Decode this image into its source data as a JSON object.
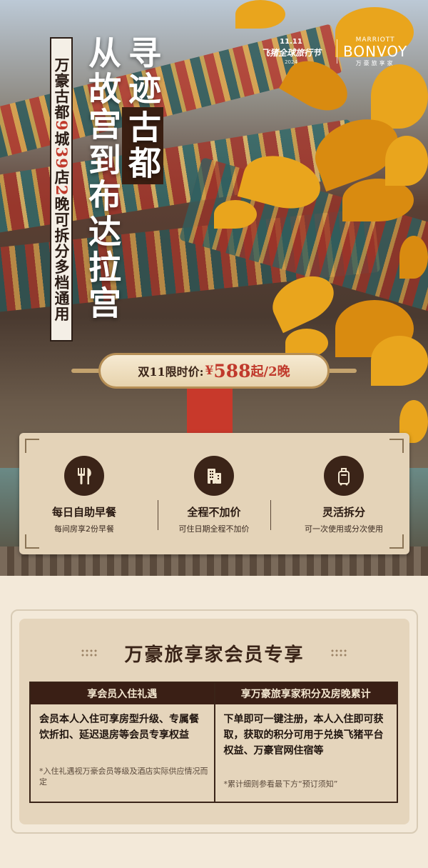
{
  "hero": {
    "vertical_tag": [
      "万豪古都",
      "9",
      "城",
      "39",
      "店",
      "2",
      "晚可拆分多档通用"
    ],
    "title_col_right_top": "寻迹",
    "title_col_right_boxed": "古都",
    "title_col_left": "从故宫到布达拉宫",
    "logos": {
      "fliggy_top": "11.11",
      "fliggy_name": "飞猪全球旅行节",
      "fliggy_year": "2024",
      "marriott_top": "MARRIOTT",
      "marriott_brand": "BONVOY",
      "marriott_cn": "万豪旅享家"
    },
    "price": {
      "label": "双11限时价:",
      "currency": "¥",
      "amount": "588",
      "suffix": "起/2晚"
    }
  },
  "features": [
    {
      "icon": "fork-knife-icon",
      "title": "每日自助早餐",
      "subtitle": "每间房享2份早餐"
    },
    {
      "icon": "building-icon",
      "title": "全程不加价",
      "subtitle": "可住日期全程不加价"
    },
    {
      "icon": "luggage-icon",
      "title": "灵活拆分",
      "subtitle": "可一次使用或分次使用"
    }
  ],
  "member": {
    "title": "万豪旅享家会员专享",
    "columns": [
      {
        "header": "享会员入住礼遇",
        "body": "会员本人入住可享房型升级、专属餐饮折扣、延迟退房等会员专享权益",
        "note": "*入住礼遇视万豪会员等级及酒店实际供应情况而定"
      },
      {
        "header": "享万豪旅享家积分及房晚累计",
        "body": "下单即可一键注册，本人入住即可获取，获取的积分可用于兑换飞猪平台权益、万豪官网住宿等",
        "note": "*累计细则参看最下方“预订须知”"
      }
    ]
  },
  "colors": {
    "accent_red": "#c0392b",
    "dark_brown": "#3a1f15",
    "panel_tan": "#e4d3b8",
    "ginkgo_gold": "#e9a51d"
  }
}
